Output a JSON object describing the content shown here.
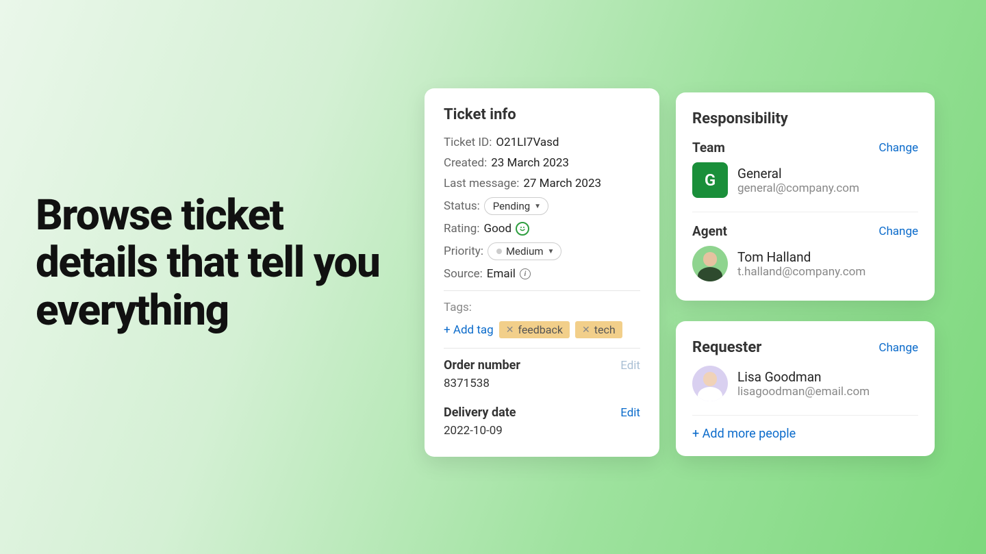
{
  "headline": "Browse ticket details that tell you everything",
  "ticket": {
    "title": "Ticket info",
    "fields": {
      "ticket_id_label": "Ticket ID:",
      "ticket_id": "O21LI7Vasd",
      "created_label": "Created:",
      "created": "23 March 2023",
      "last_message_label": "Last message:",
      "last_message": "27 March 2023",
      "status_label": "Status:",
      "status": "Pending",
      "rating_label": "Rating:",
      "rating": "Good",
      "priority_label": "Priority:",
      "priority": "Medium",
      "source_label": "Source:",
      "source": "Email"
    },
    "tags_label": "Tags:",
    "add_tag_label": "+ Add tag",
    "tags": [
      "feedback",
      "tech"
    ],
    "order_number_label": "Order number",
    "order_number": "8371538",
    "order_edit_label": "Edit",
    "delivery_date_label": "Delivery date",
    "delivery_date": "2022-10-09",
    "delivery_edit_label": "Edit"
  },
  "responsibility": {
    "title": "Responsibility",
    "team_label": "Team",
    "team_change": "Change",
    "team": {
      "initial": "G",
      "name": "General",
      "email": "general@company.com",
      "color": "#1a8f3a"
    },
    "agent_label": "Agent",
    "agent_change": "Change",
    "agent": {
      "name": "Tom Halland",
      "email": "t.halland@company.com",
      "avatar_bg": "#8fd48f",
      "avatar_skin": "#e6c2a0",
      "avatar_cloth": "#2e4a2e"
    }
  },
  "requester": {
    "title": "Requester",
    "change": "Change",
    "person": {
      "name": "Lisa Goodman",
      "email": "lisagoodman@email.com",
      "avatar_bg": "#d9d0f0",
      "avatar_skin": "#f0d2b8",
      "avatar_cloth": "#ffffff"
    },
    "add_people_label": "+ Add more people"
  }
}
